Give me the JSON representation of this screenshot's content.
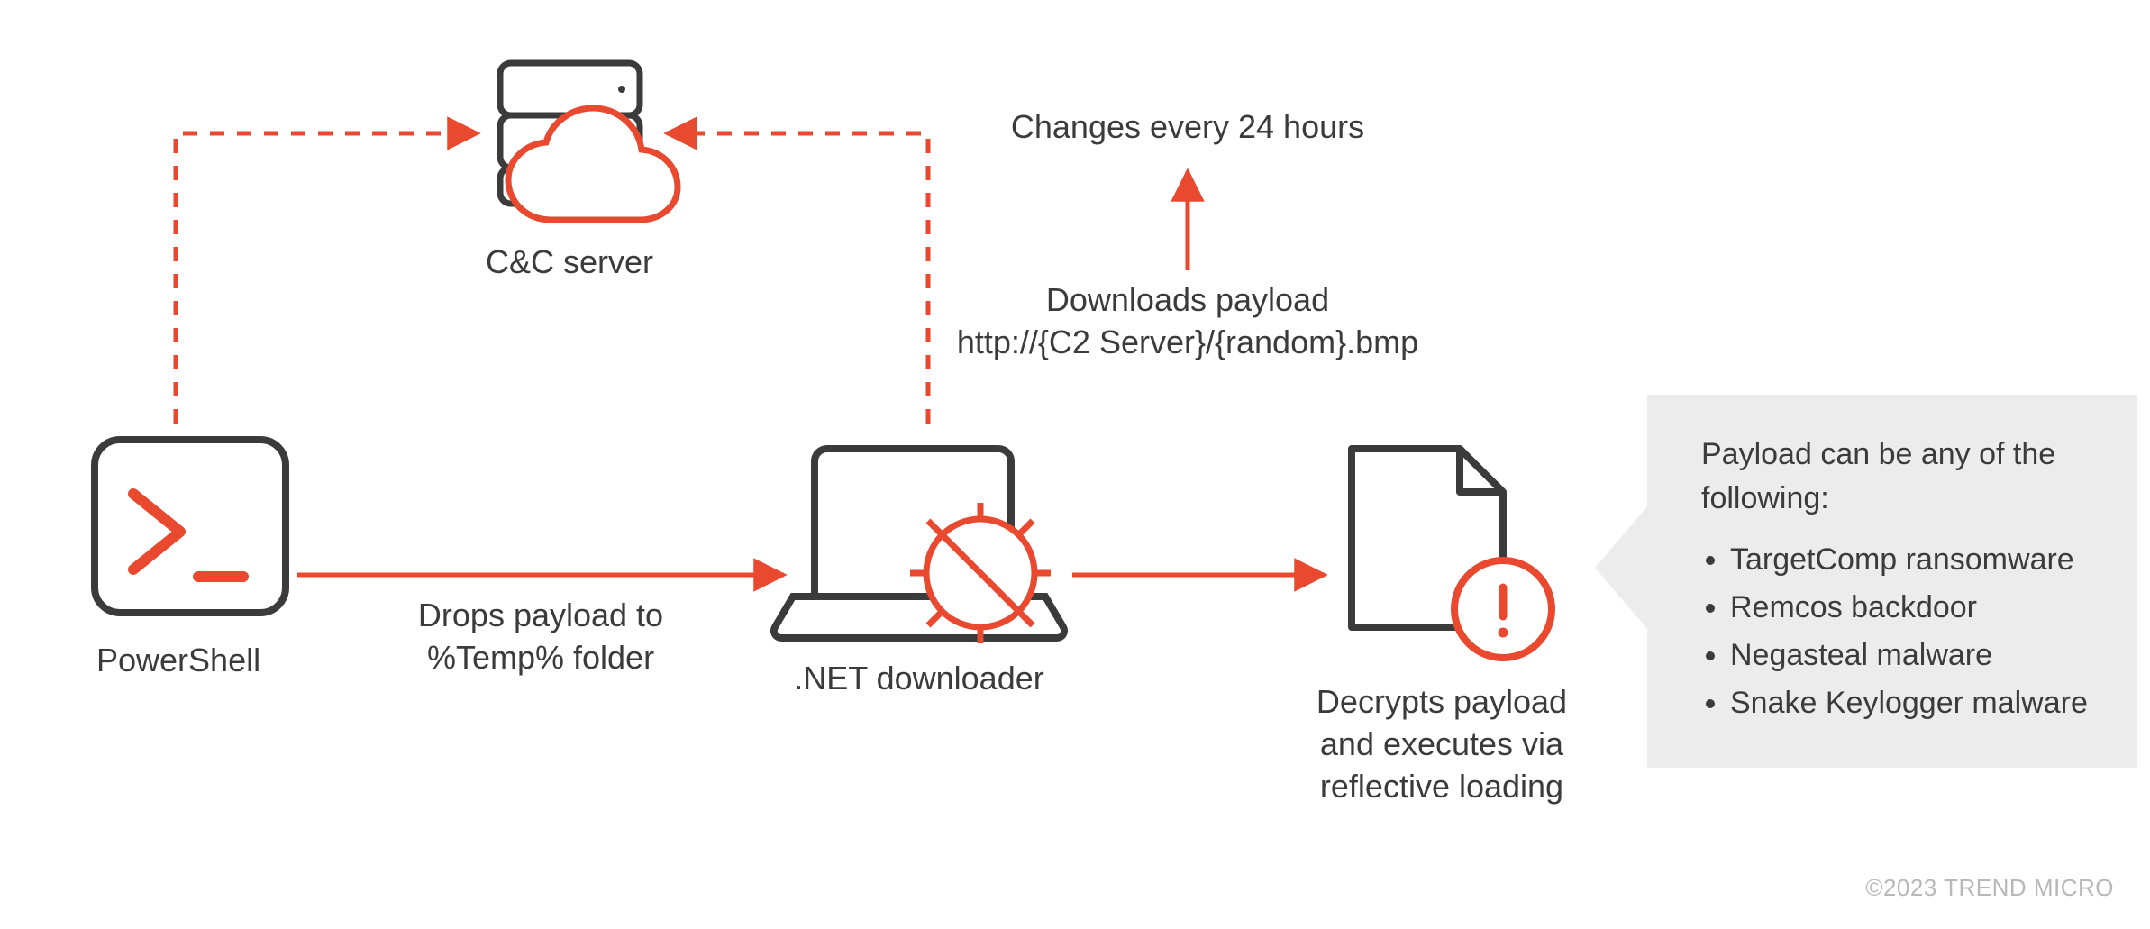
{
  "colors": {
    "accent": "#e8492f",
    "ink": "#3b3b3b",
    "panel": "#ececec"
  },
  "nodes": {
    "powershell_label": "PowerShell",
    "cc_label": "C&C server",
    "net_label": ".NET downloader",
    "decrypt_label": "Decrypts payload\nand executes via\nreflective loading"
  },
  "edges": {
    "drops_label": "Drops payload to\n%Temp% folder",
    "changes_label": "Changes every 24 hours",
    "downloads_label": "Downloads payload\nhttp://{C2 Server}/{random}.bmp"
  },
  "callout": {
    "title": "Payload can be any of the\nfollowing:",
    "items": [
      "TargetComp ransomware",
      "Remcos backdoor",
      "Negasteal malware",
      "Snake Keylogger malware"
    ]
  },
  "copyright": "©2023 TREND MICRO"
}
